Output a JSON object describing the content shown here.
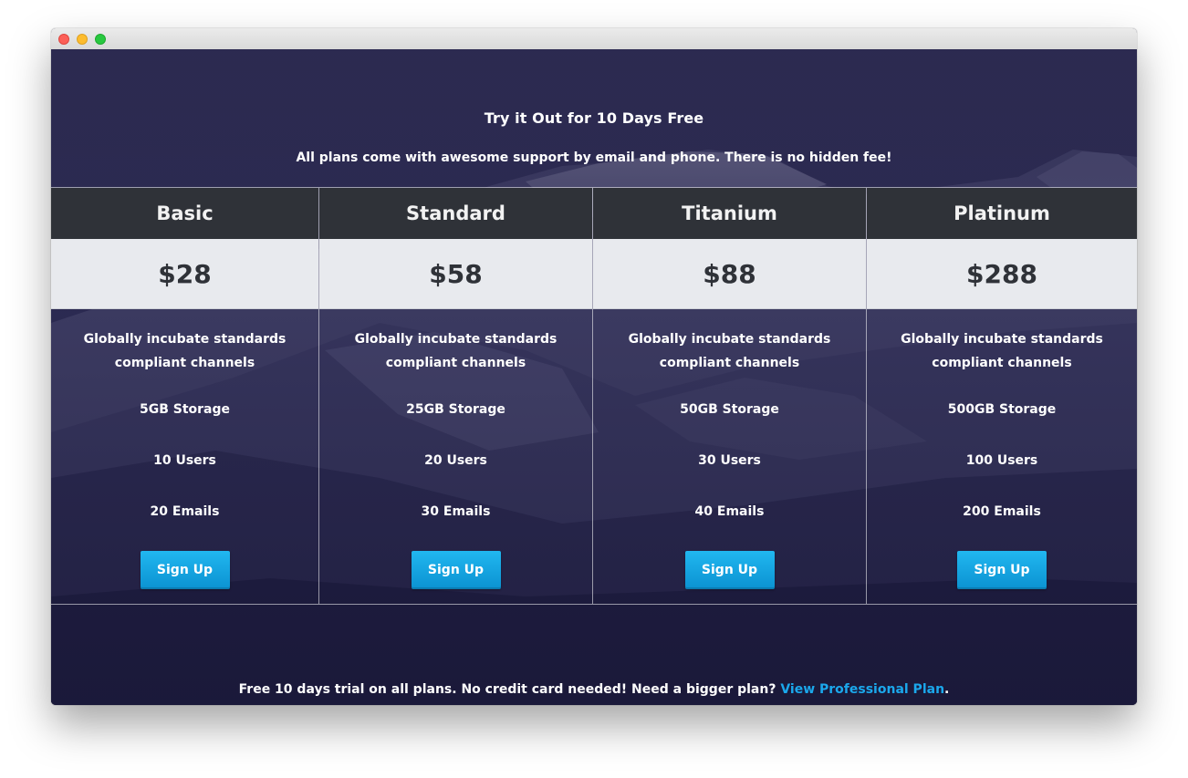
{
  "window": {
    "controls": [
      "close",
      "minimize",
      "zoom"
    ]
  },
  "hero": {
    "title": "Try it Out for 10 Days Free",
    "subtitle": "All plans come with awesome support by email and phone. There is no hidden fee!"
  },
  "plans": [
    {
      "name": "Basic",
      "price": "$28",
      "description_line1": "Globally incubate standards",
      "description_line2": "compliant channels",
      "storage": "5GB Storage",
      "users": "10 Users",
      "emails": "20 Emails",
      "button_label": "Sign Up"
    },
    {
      "name": "Standard",
      "price": "$58",
      "description_line1": "Globally incubate standards",
      "description_line2": "compliant channels",
      "storage": "25GB Storage",
      "users": "20 Users",
      "emails": "30 Emails",
      "button_label": "Sign Up"
    },
    {
      "name": "Titanium",
      "price": "$88",
      "description_line1": "Globally incubate standards",
      "description_line2": "compliant channels",
      "storage": "50GB Storage",
      "users": "30 Users",
      "emails": "40 Emails",
      "button_label": "Sign Up"
    },
    {
      "name": "Platinum",
      "price": "$288",
      "description_line1": "Globally incubate standards",
      "description_line2": "compliant channels",
      "storage": "500GB Storage",
      "users": "100 Users",
      "emails": "200 Emails",
      "button_label": "Sign Up"
    }
  ],
  "footer": {
    "text_before": "Free 10 days trial on all plans. No credit card needed! Need a bigger plan?",
    "link_label": "View Professional Plan",
    "text_after": "."
  },
  "colors": {
    "plan_header_bg": "#2f3238",
    "price_bg": "#e8eaee",
    "button_accent": "#1ba8ec",
    "link": "#1ba8ec",
    "overlay": "#2a2947"
  }
}
